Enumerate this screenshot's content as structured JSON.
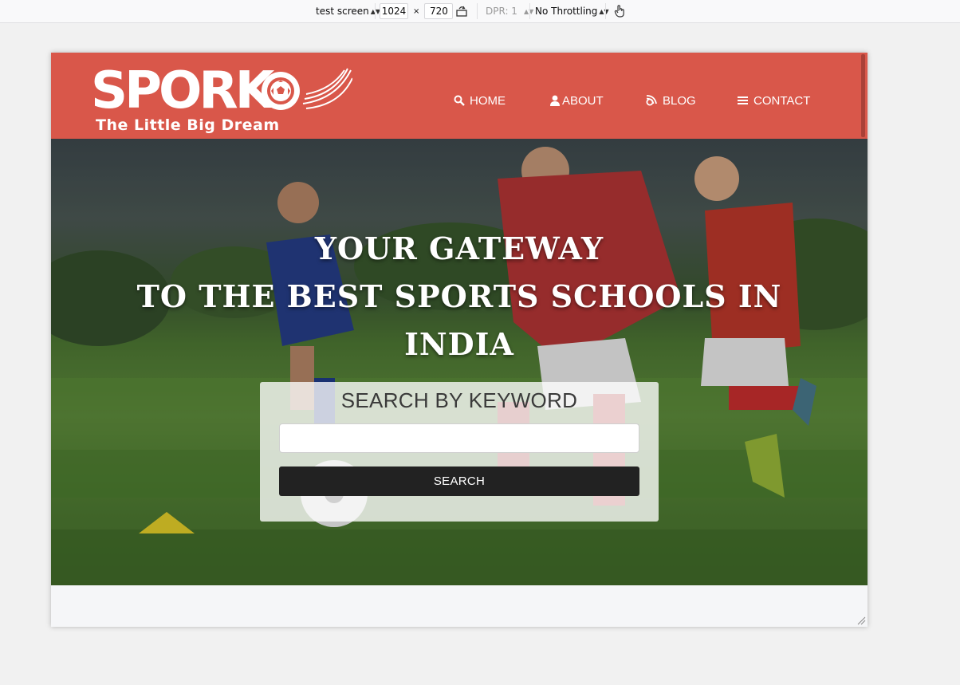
{
  "devtools": {
    "device": "test screen",
    "width": "1024",
    "times": "×",
    "height": "720",
    "dpr": "DPR: 1",
    "throttling": "No Throttling",
    "icons": [
      "rotate-icon",
      "touch-simulation-icon"
    ]
  },
  "site": {
    "logo": {
      "word": "SPORKO",
      "tagline": "The Little Big Dream"
    },
    "nav": [
      {
        "label": "HOME",
        "icon": "search-icon"
      },
      {
        "label": "ABOUT",
        "icon": "user-icon"
      },
      {
        "label": "BLOG",
        "icon": "feed-icon"
      },
      {
        "label": "CONTACT",
        "icon": "menu-icon"
      }
    ],
    "hero": {
      "line1": "YOUR GATEWAY",
      "line2": "TO THE BEST SPORTS SCHOOLS IN",
      "line3": "INDIA"
    },
    "search": {
      "title": "SEARCH BY KEYWORD",
      "input_value": "",
      "placeholder": "",
      "button_label": "SEARCH"
    }
  },
  "colors": {
    "header": "#d9574a",
    "button": "#222222",
    "toolbar": "#f9f9fa"
  }
}
